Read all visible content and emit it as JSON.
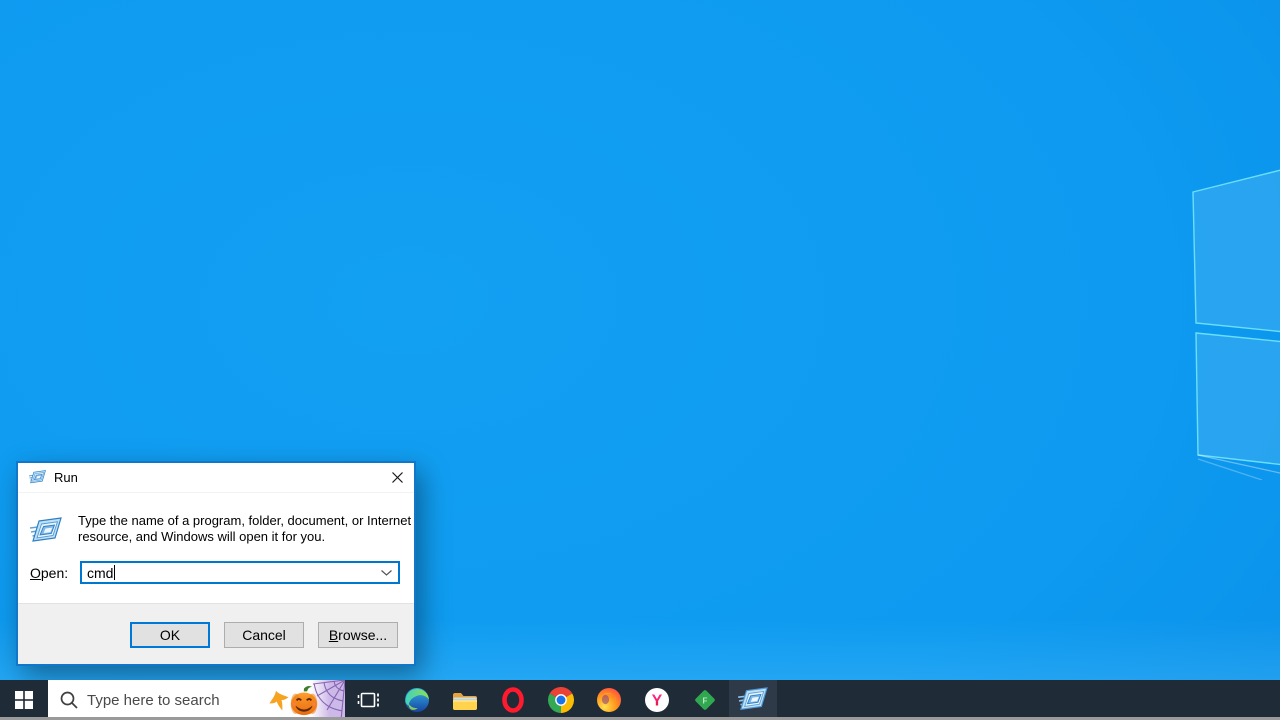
{
  "window": {
    "title": "Run",
    "description_lines": [
      "Type the name of a program, folder, document, or Internet",
      "resource, and Windows will open it for you."
    ],
    "open_label": {
      "accel": "O",
      "rest": "pen:"
    },
    "input": {
      "value": "cmd"
    },
    "buttons": {
      "ok": "OK",
      "cancel": "Cancel",
      "browse": {
        "accel": "B",
        "rest": "rowse..."
      }
    }
  },
  "taskbar": {
    "search": {
      "placeholder": "Type here to search"
    }
  },
  "colors": {
    "accent": "#0078d7",
    "dialog_border": "#1177ca",
    "taskbar_bg": "#202b38",
    "wallpaper_blue": "#0d9af0",
    "running_indicator": "#8fb9d6"
  }
}
